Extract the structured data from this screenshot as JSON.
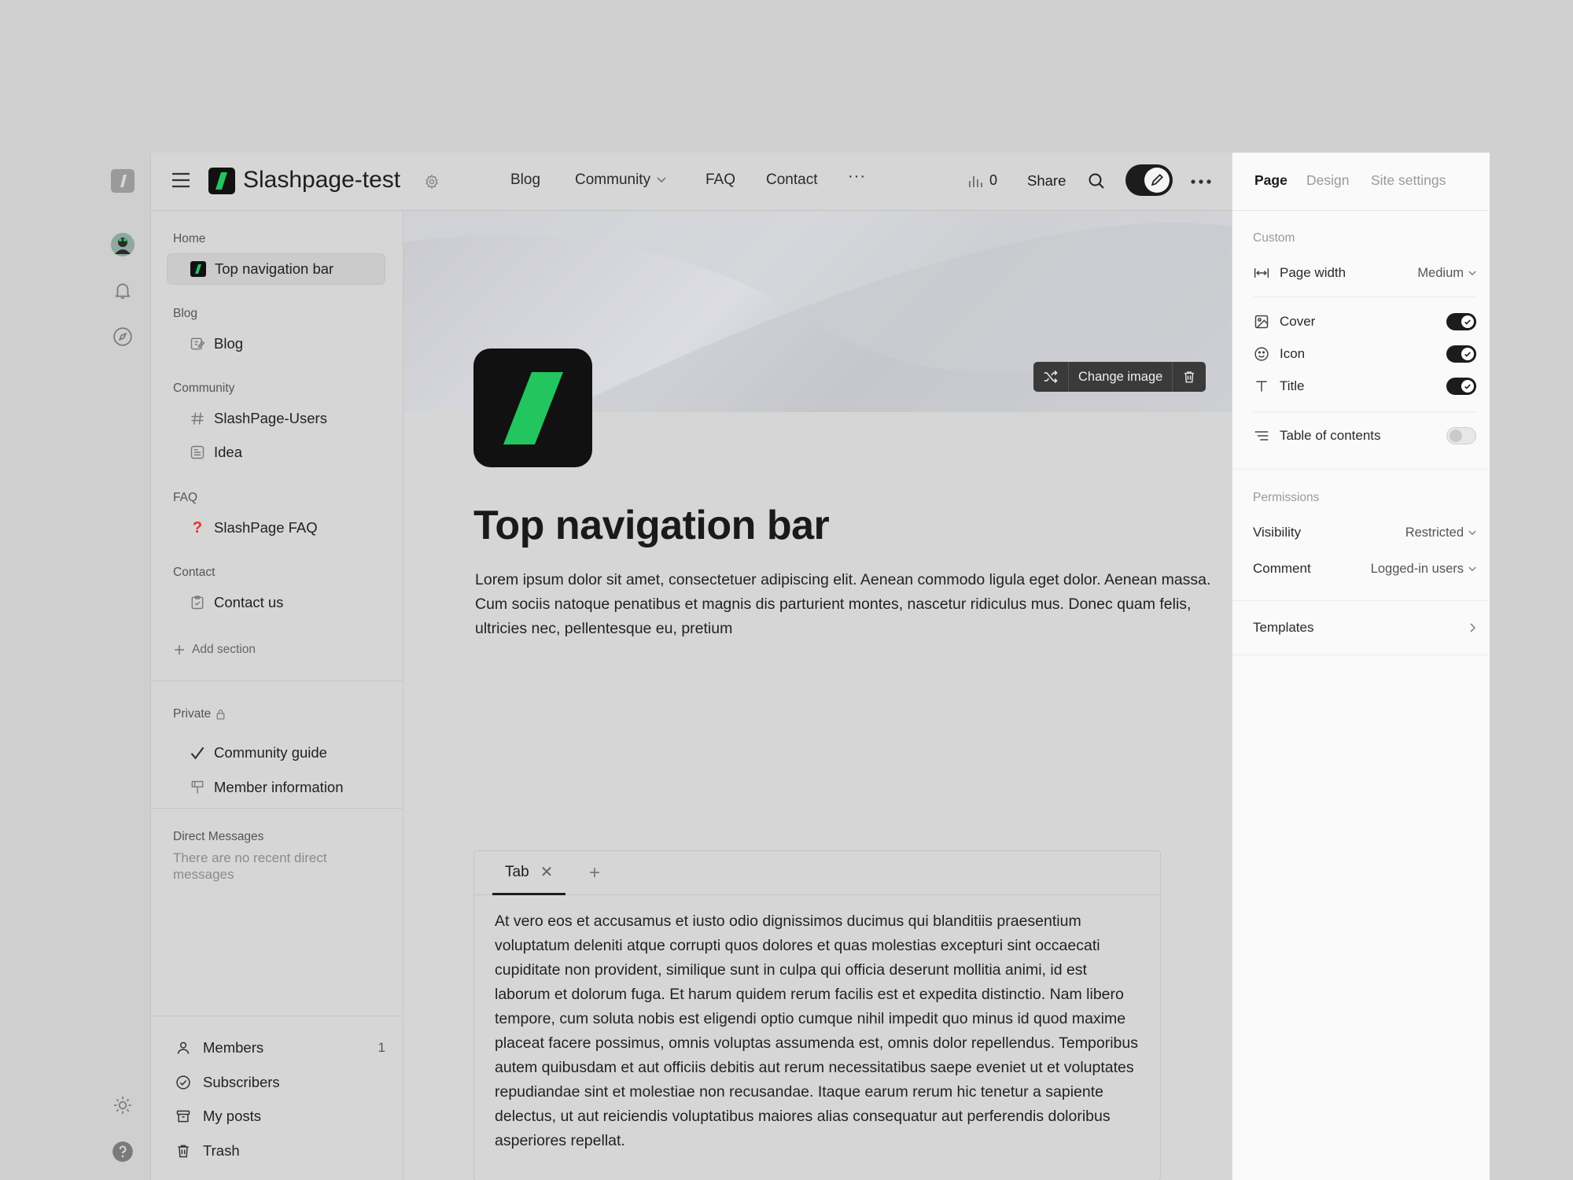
{
  "header": {
    "site_title": "Slashpage-test",
    "nav": [
      {
        "label": "Blog"
      },
      {
        "label": "Community"
      },
      {
        "label": "FAQ"
      },
      {
        "label": "Contact"
      },
      {
        "label": "···"
      }
    ],
    "views_count": "0",
    "share_label": "Share"
  },
  "sidebar": {
    "sections": {
      "home": "Home",
      "blog": "Blog",
      "community": "Community",
      "faq": "FAQ",
      "contact": "Contact",
      "private": "Private",
      "direct_messages": "Direct Messages"
    },
    "items": {
      "top_nav": "Top navigation bar",
      "blog": "Blog",
      "slashpage_users": "SlashPage-Users",
      "idea": "Idea",
      "slashpage_faq": "SlashPage FAQ",
      "contact_us": "Contact us",
      "community_guide": "Community guide",
      "member_information": "Member information"
    },
    "add_section": "Add section",
    "dm_empty": "There are no recent direct messages",
    "footer": {
      "members": "Members",
      "members_count": "1",
      "subscribers": "Subscribers",
      "my_posts": "My posts",
      "trash": "Trash"
    }
  },
  "main": {
    "change_image": "Change image",
    "title": "Top navigation bar",
    "body": "Lorem ipsum dolor sit amet, consectetuer adipiscing elit. Aenean commodo ligula eget dolor. Aenean massa. Cum sociis natoque penatibus et magnis dis parturient montes, nascetur ridiculus mus. Donec quam felis, ultricies nec, pellentesque eu, pretium",
    "tab_label": "Tab",
    "tab_content": "At vero eos et accusamus et iusto odio dignissimos ducimus qui blanditiis praesentium voluptatum deleniti atque corrupti quos dolores et quas molestias excepturi sint occaecati cupiditate non provident, similique sunt in culpa qui officia deserunt mollitia animi, id est laborum et dolorum fuga. Et harum quidem rerum facilis est et expedita distinctio. Nam libero tempore, cum soluta nobis est eligendi optio cumque nihil impedit quo minus id quod maxime placeat facere possimus, omnis voluptas assumenda est, omnis dolor repellendus. Temporibus autem quibusdam et aut officiis debitis aut rerum necessitatibus saepe eveniet ut et voluptates repudiandae sint et molestiae non recusandae. Itaque earum rerum hic tenetur a sapiente delectus, ut aut reiciendis voluptatibus maiores alias consequatur aut perferendis doloribus asperiores repellat."
  },
  "panel": {
    "tabs": {
      "page": "Page",
      "design": "Design",
      "site_settings": "Site settings"
    },
    "custom_label": "Custom",
    "page_width_label": "Page width",
    "page_width_value": "Medium",
    "cover_label": "Cover",
    "icon_label": "Icon",
    "title_label": "Title",
    "toc_label": "Table of contents",
    "permissions_label": "Permissions",
    "visibility_label": "Visibility",
    "visibility_value": "Restricted",
    "comment_label": "Comment",
    "comment_value": "Logged-in users",
    "templates_label": "Templates"
  },
  "colors": {
    "brand_green": "#22c55e",
    "dark": "#1c1c1c",
    "faq_red": "#e03131"
  },
  "toggles": {
    "cover": true,
    "icon": true,
    "title": true,
    "table_of_contents": false
  }
}
